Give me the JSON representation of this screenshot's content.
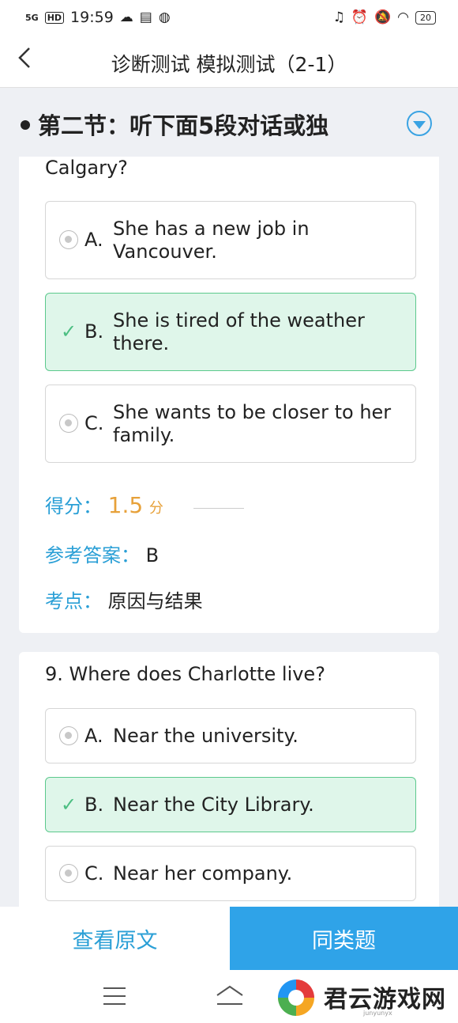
{
  "status_bar": {
    "signal": "5G",
    "hd": "HD",
    "time": "19:59",
    "battery": "20"
  },
  "header": {
    "back_icon": "chevron-left-icon",
    "title": "诊断测试 模拟测试（2-1）"
  },
  "section": {
    "title": "第二节：听下面5段对话或独",
    "dropdown_icon": "chevron-down-circle-icon"
  },
  "question8": {
    "tail_text": "Calgary?",
    "options": [
      {
        "letter": "A.",
        "line1": "She has a new job in",
        "line2": "Vancouver.",
        "state": "unselected"
      },
      {
        "letter": "B.",
        "line1": "She is tired of the weather",
        "line2": "there.",
        "state": "correct"
      },
      {
        "letter": "C.",
        "line1": "She wants to be closer to her",
        "line2": "family.",
        "state": "unselected"
      }
    ],
    "score_label": "得分：",
    "score_value": "1.5",
    "score_unit": "分",
    "answer_label": "参考答案：",
    "answer_value": "B",
    "point_label": "考点：",
    "point_value": "原因与结果"
  },
  "question9": {
    "text": "9. Where does Charlotte live?",
    "options": [
      {
        "letter": "A.",
        "text": "Near the university.",
        "state": "unselected"
      },
      {
        "letter": "B.",
        "text": "Near the City Library.",
        "state": "correct"
      },
      {
        "letter": "C.",
        "text": "Near her company.",
        "state": "unselected"
      }
    ]
  },
  "actions": {
    "view_original": "查看原文",
    "similar_questions": "同类题"
  },
  "watermark": {
    "text": "君云游戏网",
    "sub": "junyunyx"
  },
  "colors": {
    "accent_blue": "#2fa3e8",
    "correct_green": "#dff6ea",
    "score_orange": "#e7a13a"
  }
}
